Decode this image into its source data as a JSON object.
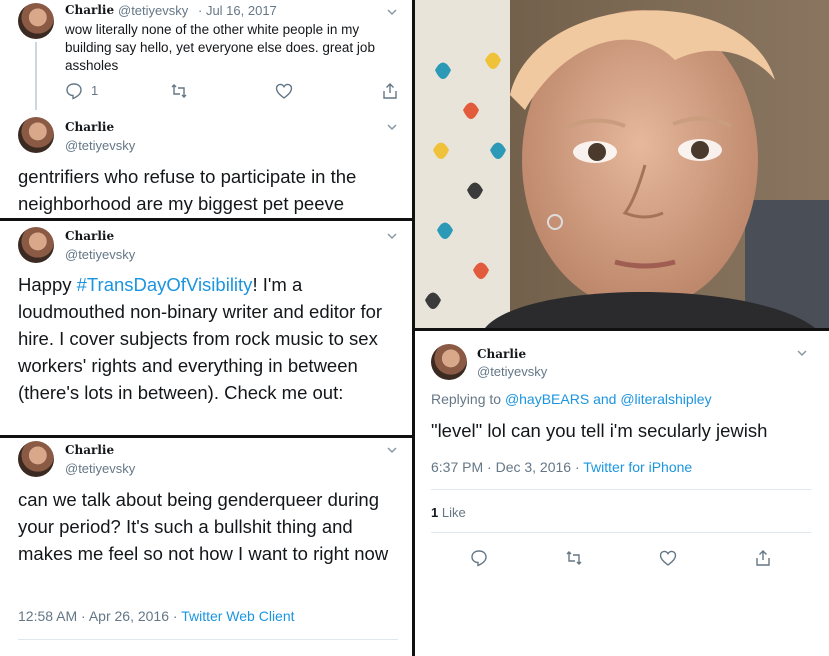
{
  "author": {
    "name": "Charlie",
    "handle": "@tetiyevsky"
  },
  "panel1": {
    "top_tweet": {
      "header_date": "· Jul 16, 2017",
      "text": "wow literally none of the other white people in my building say hello, yet everyone else does. great job assholes",
      "reply_count": "1"
    },
    "reply_text": "gentrifiers who refuse to participate in the neighborhood are my biggest pet peeve"
  },
  "panel2": {
    "text_before": "Happy ",
    "hashtag": "#TransDayOfVisibility",
    "text_after": "! I'm a loudmouthed non-binary writer and editor for hire. I cover subjects from rock music to sex workers' rights and everything in between (there's lots in between). Check me out:"
  },
  "panel3": {
    "text": "can we talk about being genderqueer during your period? It's such a bullshit thing and makes me feel so not how I want to right now",
    "timestamp": "12:58 AM · Apr 26, 2016 · ",
    "client": "Twitter Web Client"
  },
  "panel4": {
    "replying_prefix": "Replying to ",
    "reply_to_1": "@hayBEARS",
    "reply_and": " and ",
    "reply_to_2": "@literalshipley",
    "text": "\"level\" lol can you tell i'm secularly jewish",
    "timestamp": "6:37 PM · Dec 3, 2016 · ",
    "client": "Twitter for iPhone",
    "likes_count": "1",
    "likes_label": " Like"
  },
  "colors": {
    "link": "#1b95e0",
    "secondary": "#657786",
    "text": "#14171a",
    "divider": "#e1e8ed"
  }
}
